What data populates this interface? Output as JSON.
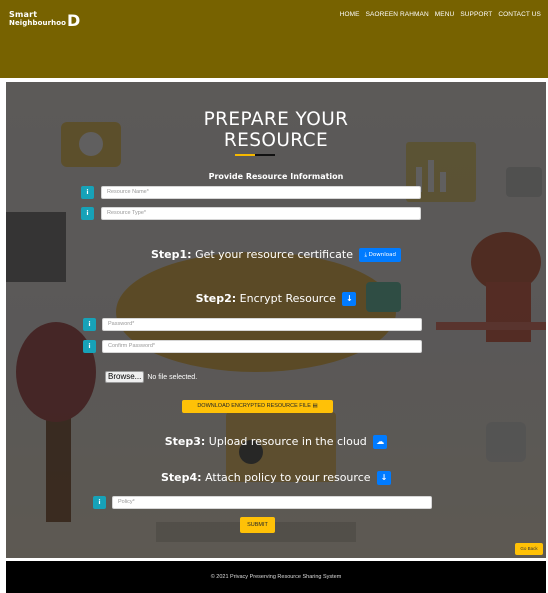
{
  "header": {
    "logo_line1": "Smart",
    "logo_line2": "Neighbourhoo",
    "logo_letter": "D",
    "nav": [
      "HOME",
      "SAOREEN RAHMAN",
      "MENU",
      "SUPPORT",
      "CONTACT US"
    ],
    "bg_color": "#776200"
  },
  "page": {
    "title_line1": "PREPARE YOUR",
    "title_line2": "RESOURCE",
    "subtitle": "Provide Resource Information",
    "info_icon": "i",
    "resource_name_placeholder": "Resource Name*",
    "resource_type_placeholder": "Resource Type*",
    "step1_label": "Step1:",
    "step1_text": "Get your resource certificate",
    "download_label": "Download",
    "step2_label": "Step2:",
    "step2_text": "Encrypt Resource",
    "password_placeholder": "Password*",
    "confirm_password_placeholder": "Confirm Password*",
    "browse_label": "Browse...",
    "no_file_text": "No file selected.",
    "download_encrypted_label": "DOWNLOAD ENCRYPTED RESOURCE FILE",
    "step3_label": "Step3:",
    "step3_text": "Upload resource in the cloud",
    "step4_label": "Step4:",
    "step4_text": "Attach policy to your resource",
    "policy_placeholder": "Policy*",
    "submit_label": "SUBMIT",
    "go_back_label": "Go Back",
    "accent_blue": "#007bff",
    "accent_yellow": "#ffc107",
    "info_color": "#17a2b8"
  },
  "footer": {
    "text": "© 2021 Privacy Preserving Resource Sharing System"
  }
}
